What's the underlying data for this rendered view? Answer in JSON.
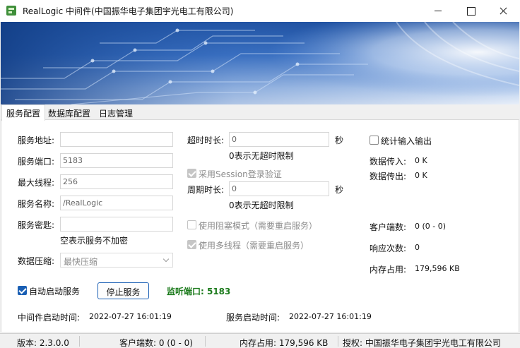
{
  "window": {
    "title": "RealLogic 中间件(中国振华电子集团宇光电工有限公司)"
  },
  "tabs": [
    {
      "label": "服务配置",
      "active": true
    },
    {
      "label": "数据库配置",
      "active": false
    },
    {
      "label": "日志管理",
      "active": false
    }
  ],
  "service": {
    "address_label": "服务地址:",
    "address_value": "",
    "port_label": "服务端口:",
    "port_value": "5183",
    "threads_label": "最大线程:",
    "threads_value": "256",
    "name_label": "服务名称:",
    "name_value": "/RealLogic",
    "key_label": "服务密匙:",
    "key_value": "",
    "key_hint": "空表示服务不加密",
    "compress_label": "数据压缩:",
    "compress_value": "最快压缩"
  },
  "timeouts": {
    "timeout_label": "超时时长:",
    "timeout_value": "0",
    "timeout_unit": "秒",
    "timeout_hint": "0表示无超时限制",
    "session_label": "采用Session登录验证",
    "session_checked": true,
    "period_label": "周期时长:",
    "period_value": "0",
    "period_unit": "秒",
    "period_hint": "0表示无超时限制",
    "blocking_label": "使用阻塞模式（需要重启服务）",
    "blocking_checked": false,
    "multithread_label": "使用多线程（需要重启服务）",
    "multithread_checked": true
  },
  "stats": {
    "io_label": "统计输入输出",
    "io_checked": false,
    "in_label": "数据传入:",
    "in_value": "0 K",
    "out_label": "数据传出:",
    "out_value": "0 K",
    "clients_label": "客户端数:",
    "clients_value": "0 (0 - 0)",
    "responses_label": "响应次数:",
    "responses_value": "0",
    "memory_label": "内存占用:",
    "memory_value": "179,596 KB"
  },
  "controls": {
    "autostart_label": "自动启动服务",
    "autostart_checked": true,
    "stop_button": "停止服务",
    "listen_status": "监听端口: 5183"
  },
  "times": {
    "middleware_label": "中间件启动时间:",
    "middleware_value": "2022-07-27 16:01:19",
    "service_label": "服务启动时间:",
    "service_value": "2022-07-27 16:01:19"
  },
  "statusbar": {
    "version": "版本: 2.3.0.0",
    "clients": "客户端数: 0 (0 - 0)",
    "memory": "内存占用: 179,596 KB",
    "license": "授权: 中国振华电子集团宇光电工有限公司"
  },
  "colors": {
    "accent": "#1a5fb4",
    "status_green": "#1b7a1b"
  }
}
